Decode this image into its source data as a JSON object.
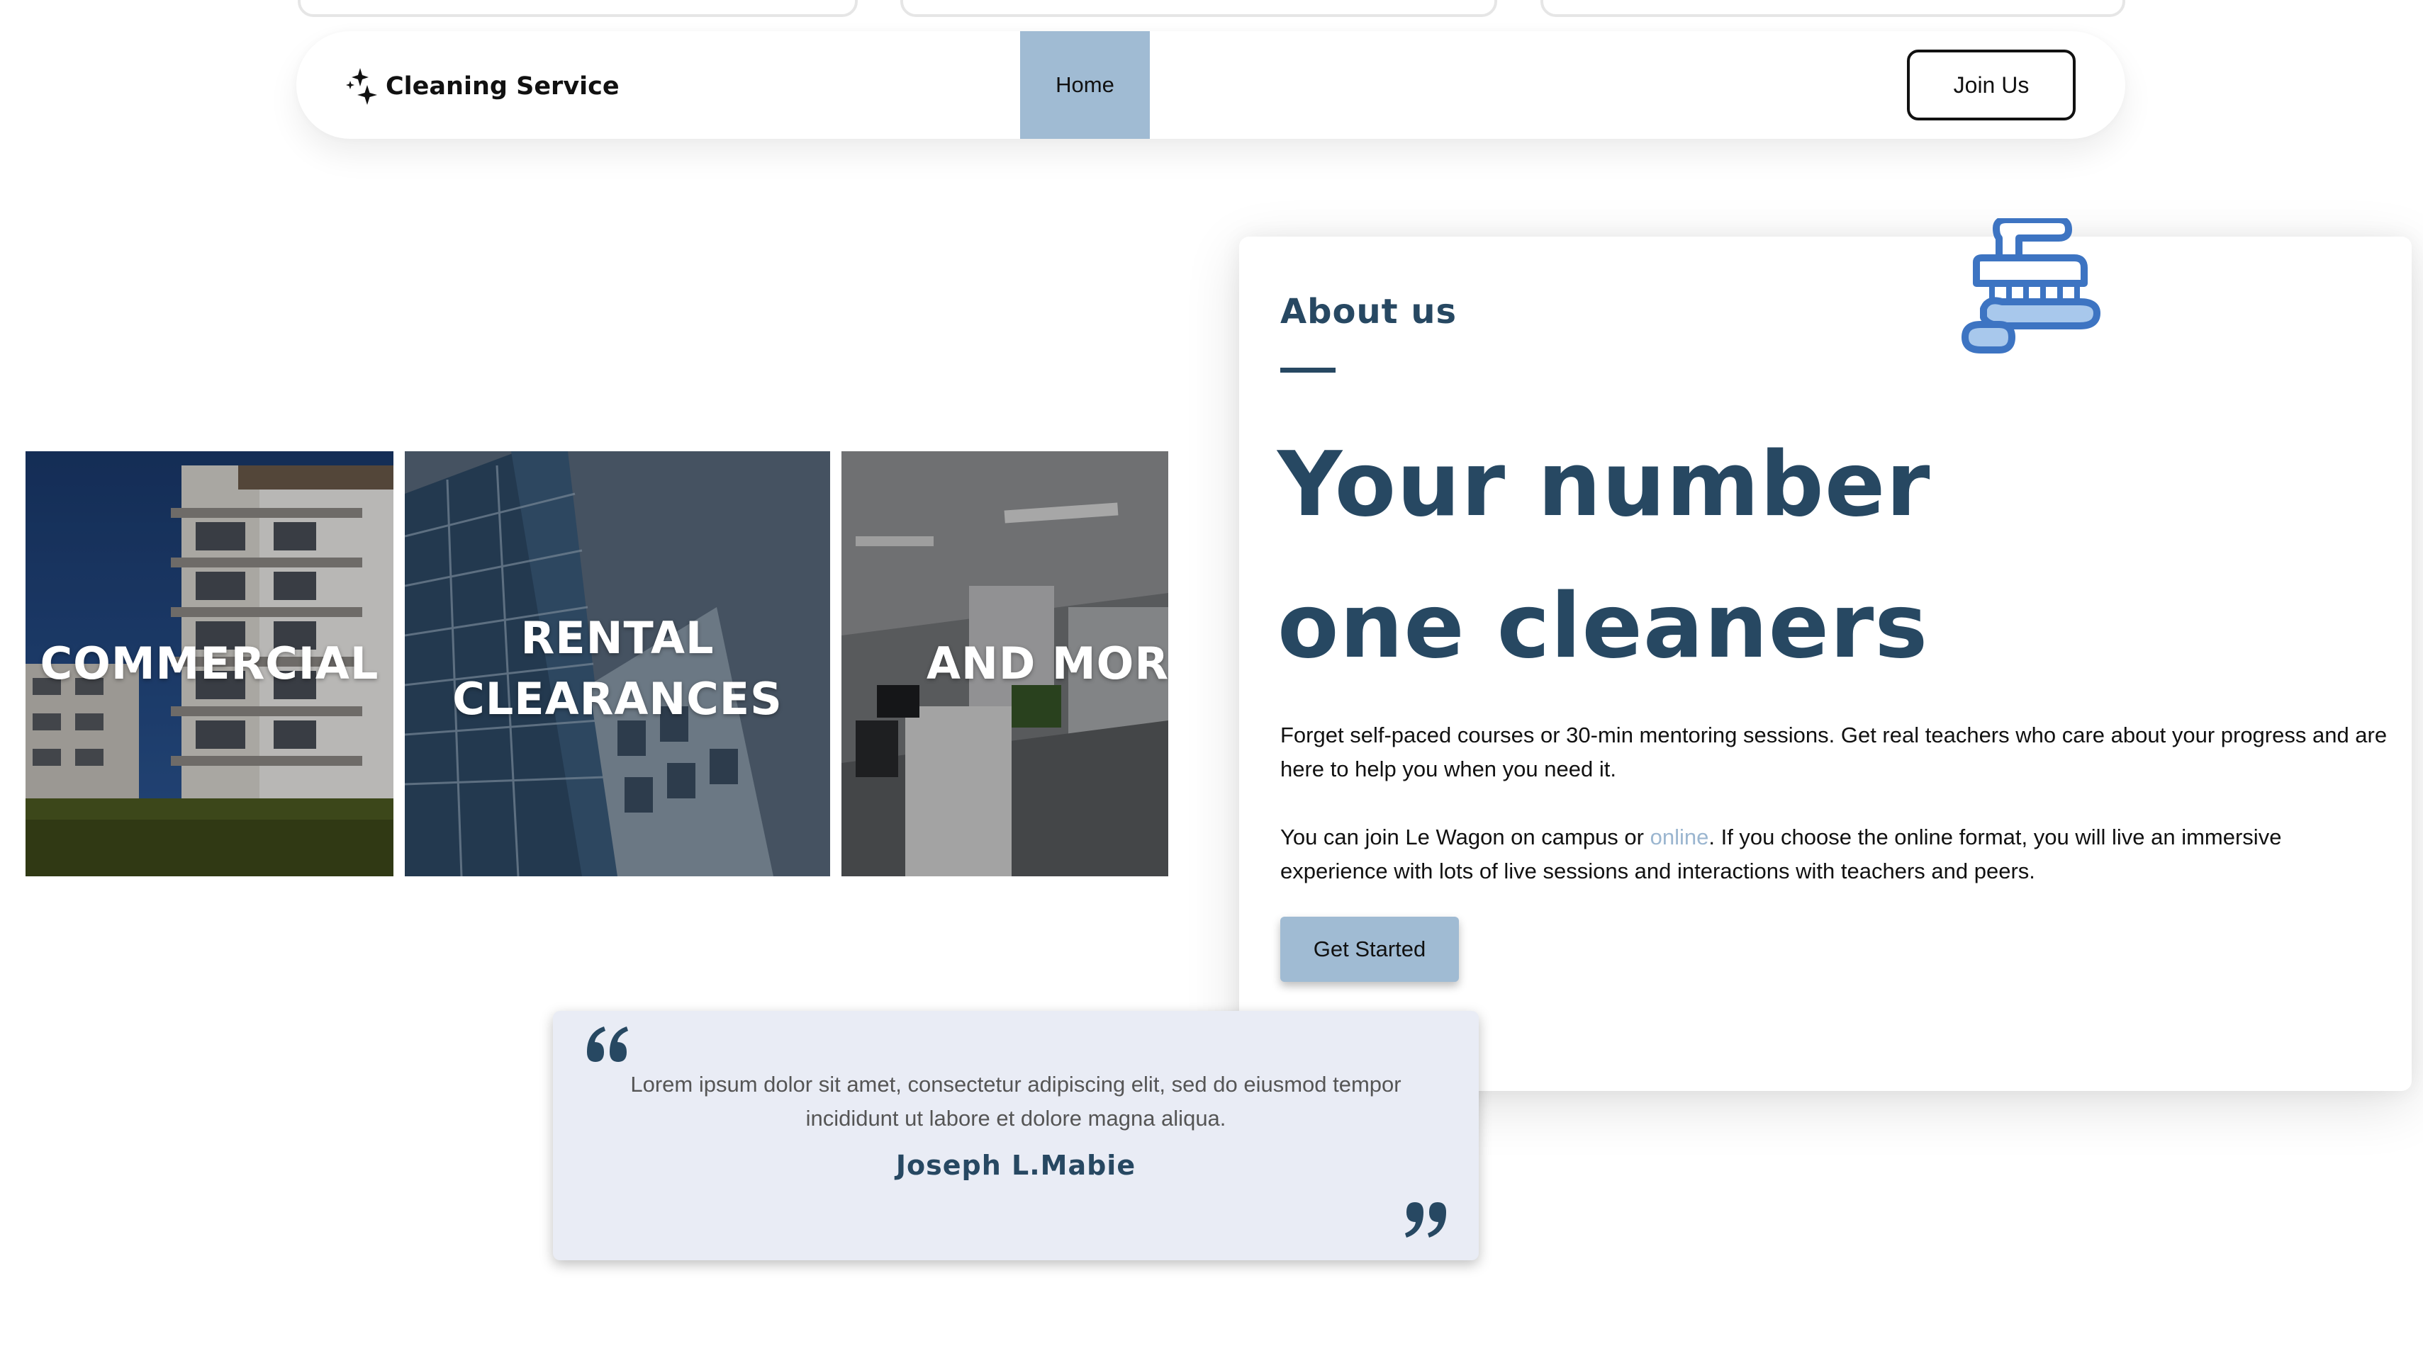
{
  "navbar": {
    "brand": "Cleaning Service",
    "home_label": "Home",
    "join_label": "Join Us"
  },
  "tiles": [
    {
      "label": "COMMERCIAL"
    },
    {
      "label_line1": "RENTAL",
      "label_line2": "CLEARANCES"
    },
    {
      "label": "AND MORE"
    }
  ],
  "about": {
    "eyebrow": "About us",
    "headline_line1": "Your number",
    "headline_line2": "one cleaners",
    "paragraph1": "Forget self-paced courses or 30-min mentoring sessions. Get real teachers who care about your progress and are here to help you when you need it.",
    "paragraph2_before": "You can join Le Wagon on campus or ",
    "paragraph2_link": "online",
    "paragraph2_after": ". If you choose the online format, you will live an immersive experience with lots of live sessions and interactions with teachers and peers.",
    "cta_label": "Get Started"
  },
  "testimonial": {
    "quote": "Lorem ipsum dolor sit amet, consectetur adipiscing elit, sed do eiusmod tempor incididunt ut labore et dolore magna aliqua.",
    "author": "Joseph L.Mabie"
  },
  "colors": {
    "brand_navy": "#274862",
    "accent_blue": "#a0bbd3",
    "link_blue": "#9bb6d0",
    "testimonial_bg": "#e9ecf5"
  },
  "icons": {
    "brand": "sparkles-icon",
    "about": "scrub-brush-icon",
    "quote_open": "quote-open-icon",
    "quote_close": "quote-close-icon"
  }
}
